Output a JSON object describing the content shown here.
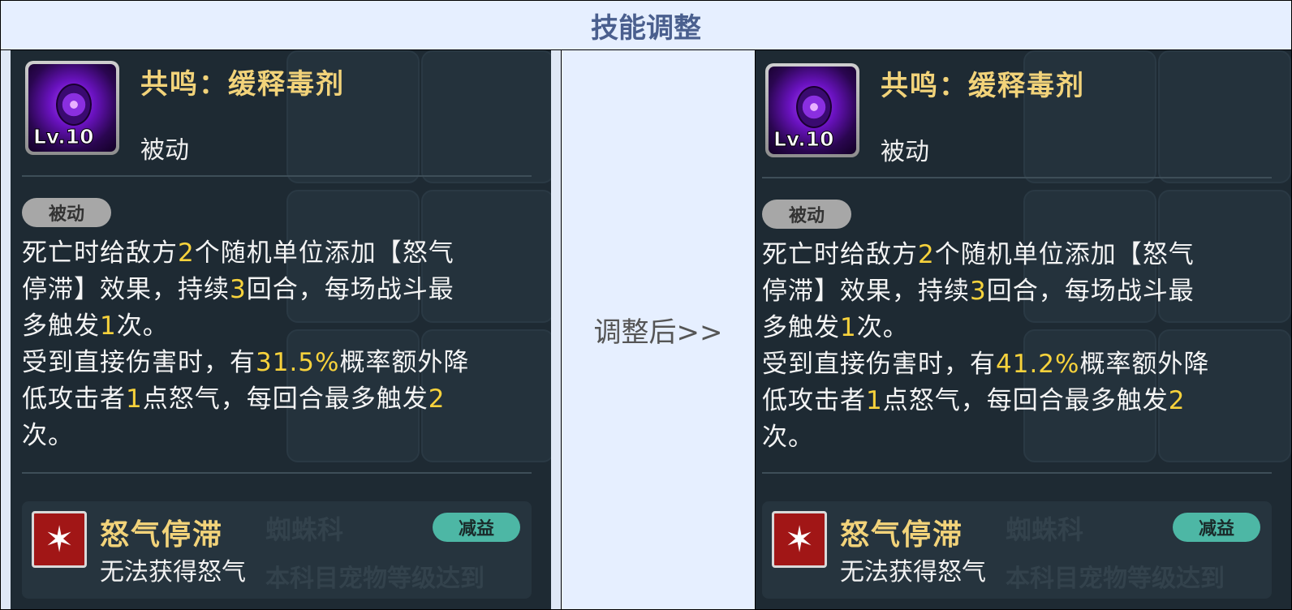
{
  "header": {
    "title": "技能调整"
  },
  "middle": {
    "text": "调整后>>"
  },
  "before": {
    "skill_name": "共鸣：缓释毒剂",
    "level": "Lv.10",
    "skill_type": "被动",
    "tag": "被动",
    "desc": {
      "l1a": "死亡时给敌方",
      "l1n": "2",
      "l1b": "个随机单位添加【怒气",
      "l2a": "停滞】效果，持续",
      "l2n": "3",
      "l2b": "回合，每场战斗最",
      "l3a": "多触发",
      "l3n": "1",
      "l3b": "次。",
      "l4a": "受到直接伤害时，有",
      "l4n": "31.5%",
      "l4b": "概率额外降",
      "l5a": "低攻击者",
      "l5n": "1",
      "l5b": "点怒气，每回合最多触发",
      "l5n2": "2",
      "l6a": "次。"
    },
    "status": {
      "title": "怒气停滞",
      "desc": "无法获得怒气",
      "badge": "减益"
    },
    "ghost_text": {
      "family": "蜘蛛科",
      "footer": "本科目宠物等级达到"
    }
  },
  "after": {
    "skill_name": "共鸣：缓释毒剂",
    "level": "Lv.10",
    "skill_type": "被动",
    "tag": "被动",
    "desc": {
      "l1a": "死亡时给敌方",
      "l1n": "2",
      "l1b": "个随机单位添加【怒气",
      "l2a": "停滞】效果，持续",
      "l2n": "3",
      "l2b": "回合，每场战斗最",
      "l3a": "多触发",
      "l3n": "1",
      "l3b": "次。",
      "l4a": "受到直接伤害时，有",
      "l4n": "41.2%",
      "l4b": "概率额外降",
      "l5a": "低攻击者",
      "l5n": "1",
      "l5b": "点怒气，每回合最多触发",
      "l5n2": "2",
      "l6a": "次。"
    },
    "status": {
      "title": "怒气停滞",
      "desc": "无法获得怒气",
      "badge": "减益"
    },
    "ghost_text": {
      "family": "蜘蛛科",
      "footer": "本科目宠物等级达到"
    }
  },
  "colors": {
    "highlight": "#f7d23c",
    "title_gold": "#f2d37a",
    "panel_bg": "#1e2a33",
    "header_text": "#4a5f8e",
    "badge_teal": "#4db7a5"
  }
}
